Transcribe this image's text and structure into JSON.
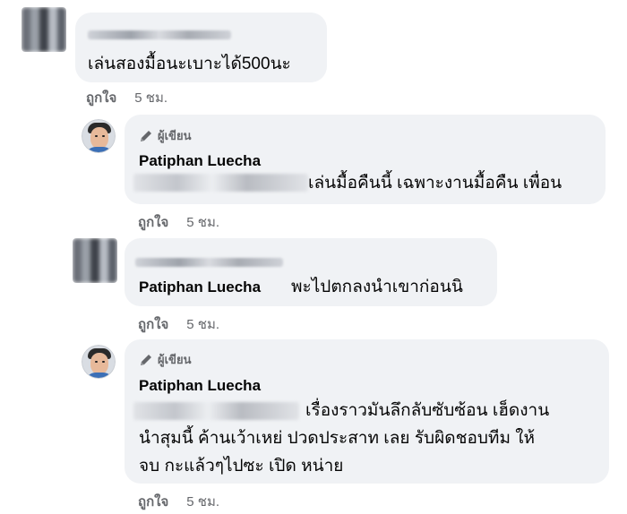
{
  "comments": [
    {
      "text": "เล่นสองมื้อนะเบาะได้500นะ",
      "like_label": "ถูกใจ",
      "time": "5 ชม."
    },
    {
      "author_badge": "ผู้เขียน",
      "name": "Patiphan Luecha",
      "text": "เล่นมื้อคืนนี้ เฉพาะงานมื้อคืน เพื่อน",
      "like_label": "ถูกใจ",
      "time": "5 ชม."
    },
    {
      "mention": "Patiphan Luecha",
      "text": "พะไปตกลงนำเขาก่อนนิ",
      "like_label": "ถูกใจ",
      "time": "5 ชม."
    },
    {
      "author_badge": "ผู้เขียน",
      "name": "Patiphan Luecha",
      "text_lines": [
        "เรื่องราวมันลึกลับซับซ้อน เฮ็ดงาน",
        "นำสุมนี้ ค้านเว้าเหย่ ปวดประสาท เลย รับผิดชอบทีม ให้",
        "จบ กะแล้วๆไปซะ เปิด หน่าย"
      ],
      "like_label": "ถูกใจ",
      "time": "5 ชม."
    }
  ],
  "colors": {
    "bubble": "#f0f2f5",
    "secondary_text": "#65676b",
    "primary_text": "#050505"
  }
}
